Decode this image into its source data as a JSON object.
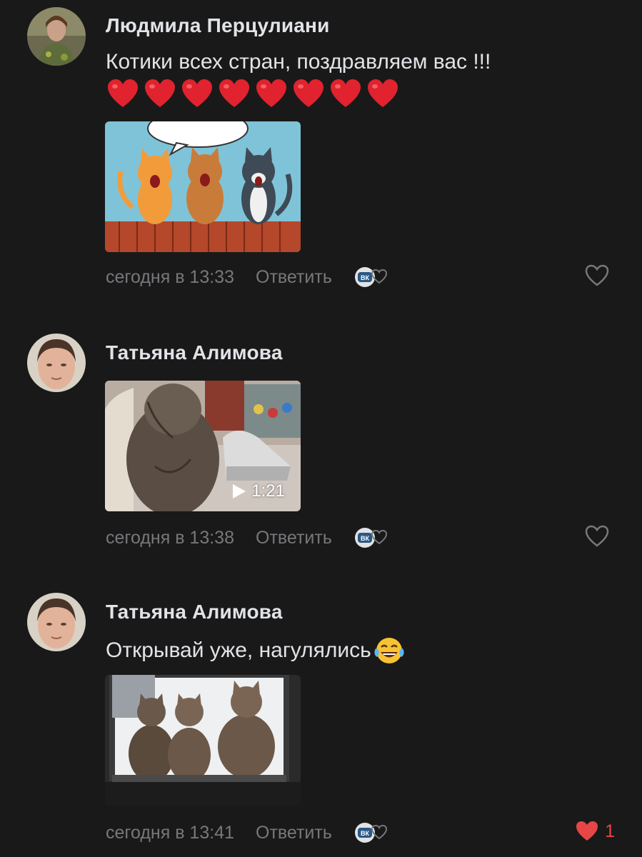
{
  "comments": [
    {
      "author": "Людмила Перцулиани",
      "text": "Котики всех стран, поздравляем вас !!!",
      "hearts": [
        "❤",
        "❤",
        "❤",
        "❤",
        "❤",
        "❤",
        "❤",
        "❤"
      ],
      "time": "сегодня в 13:33",
      "reply": "Ответить",
      "vk_badge": "ВК",
      "likes": ""
    },
    {
      "author": "Татьяна Алимова",
      "video_duration": "1:21",
      "time": "сегодня в 13:38",
      "reply": "Ответить",
      "vk_badge": "ВК",
      "likes": ""
    },
    {
      "author": "Татьяна Алимова",
      "text": "Открывай уже, нагулялись",
      "time": "сегодня в 13:41",
      "reply": "Ответить",
      "vk_badge": "ВК",
      "likes": "1"
    }
  ],
  "colors": {
    "background": "#19191a",
    "text_primary": "#e1e3e6",
    "text_secondary": "#76787a",
    "like_active": "#e64646"
  }
}
